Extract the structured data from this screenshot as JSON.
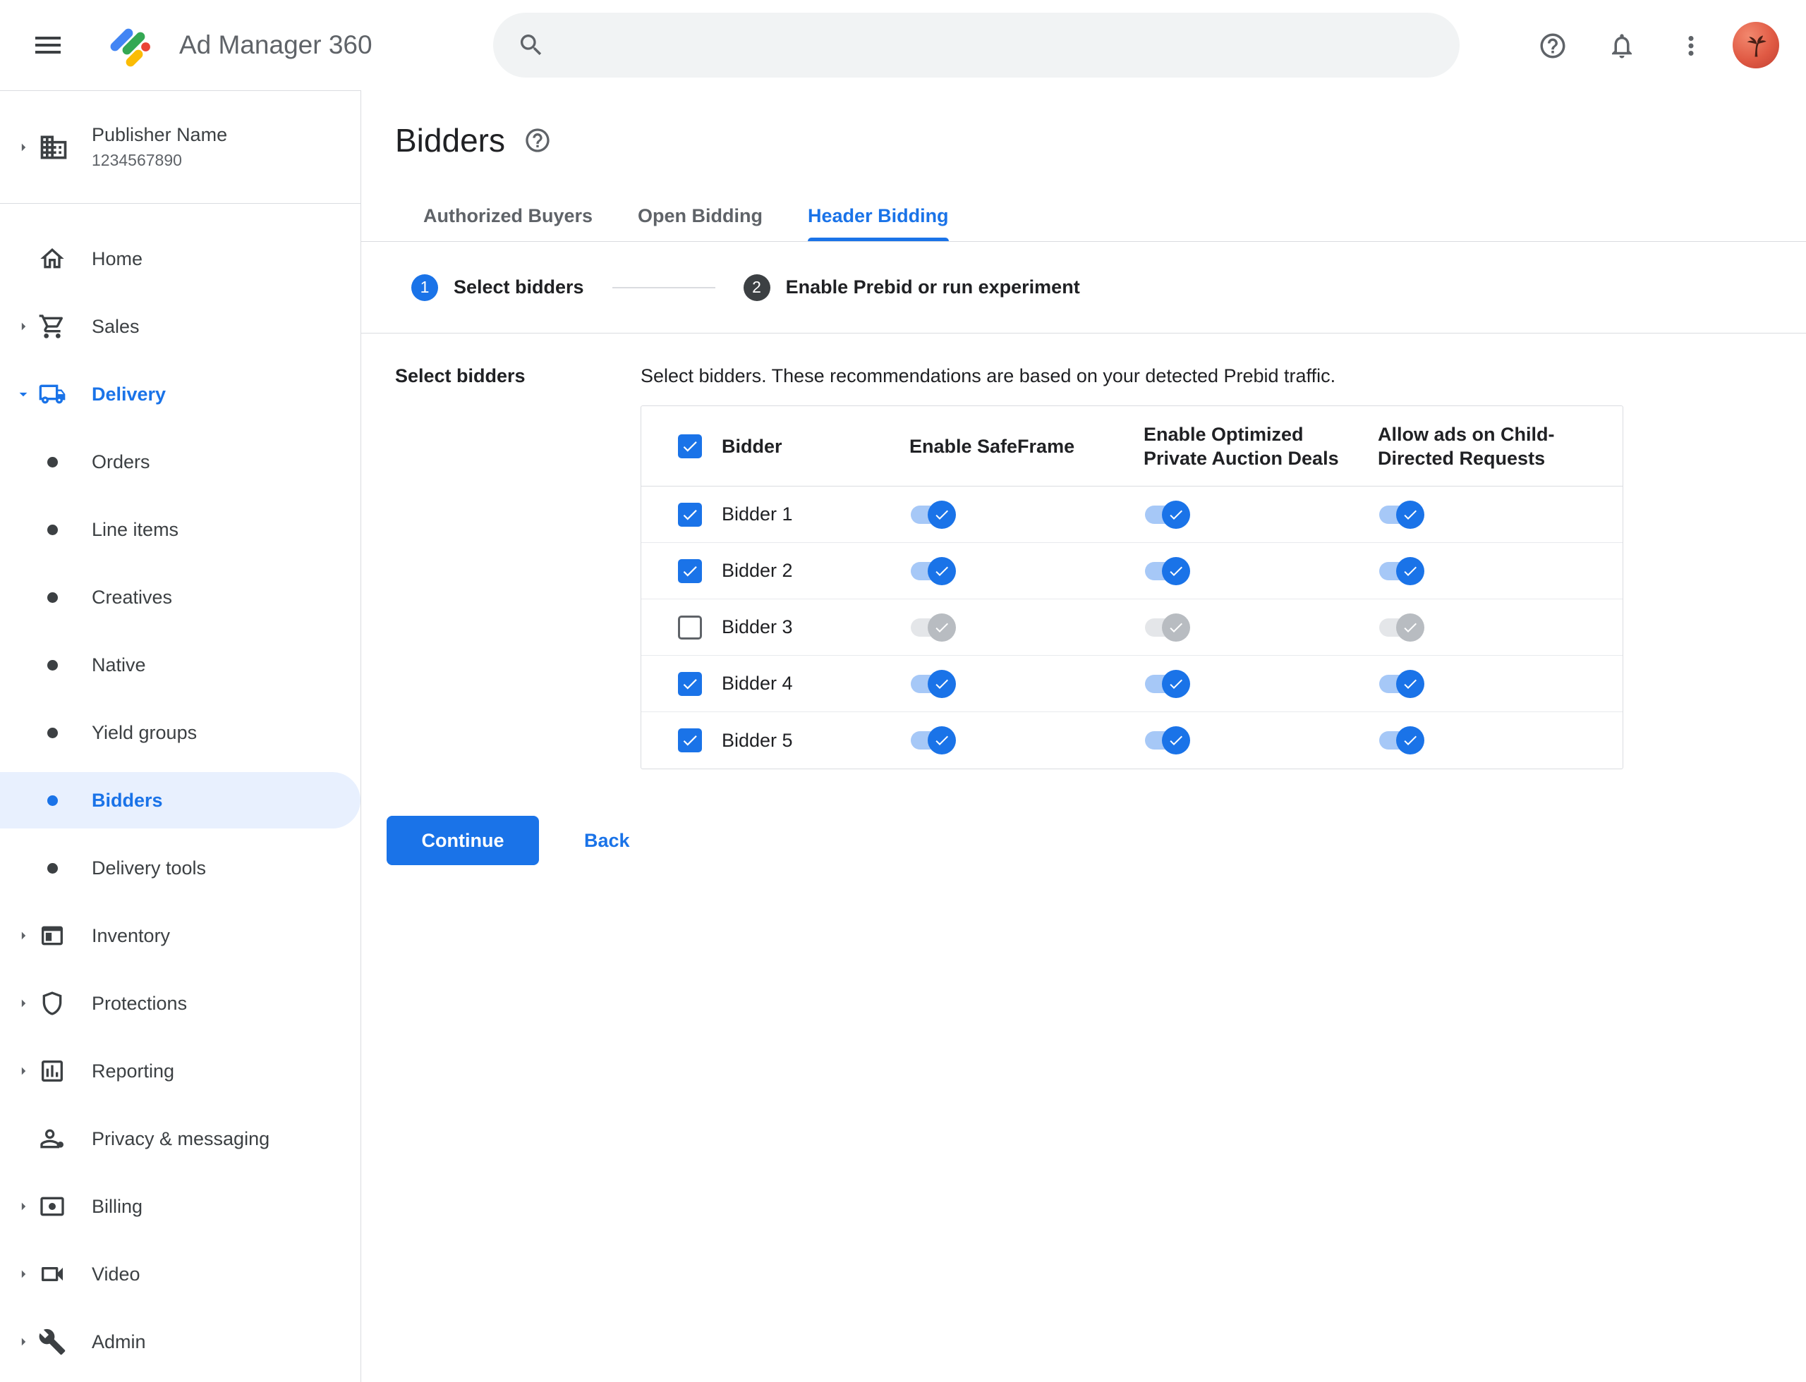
{
  "topbar": {
    "app_title": "Ad Manager 360",
    "search_value": ""
  },
  "sidebar": {
    "publisher_name": "Publisher Name",
    "publisher_id": "1234567890",
    "items": [
      {
        "label": "Home",
        "icon": "home-icon",
        "arrow": "none",
        "level": 0
      },
      {
        "label": "Sales",
        "icon": "cart-icon",
        "arrow": "right",
        "level": 0
      },
      {
        "label": "Delivery",
        "icon": "truck-icon",
        "arrow": "down",
        "level": 0,
        "active": true
      },
      {
        "label": "Orders",
        "icon": "bullet",
        "arrow": "none",
        "level": 1
      },
      {
        "label": "Line items",
        "icon": "bullet",
        "arrow": "none",
        "level": 1
      },
      {
        "label": "Creatives",
        "icon": "bullet",
        "arrow": "none",
        "level": 1
      },
      {
        "label": "Native",
        "icon": "bullet",
        "arrow": "none",
        "level": 1
      },
      {
        "label": "Yield groups",
        "icon": "bullet",
        "arrow": "none",
        "level": 1
      },
      {
        "label": "Bidders",
        "icon": "bullet",
        "arrow": "none",
        "level": 1,
        "selected": true
      },
      {
        "label": "Delivery tools",
        "icon": "bullet",
        "arrow": "none",
        "level": 1
      },
      {
        "label": "Inventory",
        "icon": "inventory-icon",
        "arrow": "right",
        "level": 0
      },
      {
        "label": "Protections",
        "icon": "shield-icon",
        "arrow": "right",
        "level": 0
      },
      {
        "label": "Reporting",
        "icon": "report-icon",
        "arrow": "right",
        "level": 0
      },
      {
        "label": "Privacy & messaging",
        "icon": "privacy-icon",
        "arrow": "none",
        "level": 0
      },
      {
        "label": "Billing",
        "icon": "billing-icon",
        "arrow": "right",
        "level": 0
      },
      {
        "label": "Video",
        "icon": "video-icon",
        "arrow": "right",
        "level": 0
      },
      {
        "label": "Admin",
        "icon": "admin-icon",
        "arrow": "right",
        "level": 0
      }
    ]
  },
  "main": {
    "page_title": "Bidders",
    "tabs": [
      {
        "label": "Authorized Buyers",
        "active": false
      },
      {
        "label": "Open Bidding",
        "active": false
      },
      {
        "label": "Header Bidding",
        "active": true
      }
    ],
    "stepper": [
      {
        "number": "1",
        "label": "Select bidders",
        "state": "active"
      },
      {
        "number": "2",
        "label": "Enable Prebid or run experiment",
        "state": "upcoming"
      }
    ],
    "section_label": "Select bidders",
    "description": "Select bidders. These recommendations are based on your detected Prebid traffic.",
    "table": {
      "columns": [
        "Bidder",
        "Enable SafeFrame",
        "Enable Optimized Private Auction Deals",
        "Allow ads on Child-Directed Requests"
      ],
      "header_checkbox_checked": true,
      "rows": [
        {
          "name": "Bidder 1",
          "checked": true,
          "safeframe": true,
          "optimized_deals": true,
          "child_directed": true
        },
        {
          "name": "Bidder 2",
          "checked": true,
          "safeframe": true,
          "optimized_deals": true,
          "child_directed": true
        },
        {
          "name": "Bidder 3",
          "checked": false,
          "safeframe": false,
          "optimized_deals": false,
          "child_directed": false
        },
        {
          "name": "Bidder 4",
          "checked": true,
          "safeframe": true,
          "optimized_deals": true,
          "child_directed": true
        },
        {
          "name": "Bidder 5",
          "checked": true,
          "safeframe": true,
          "optimized_deals": true,
          "child_directed": true
        }
      ]
    },
    "continue_label": "Continue",
    "back_label": "Back"
  },
  "colors": {
    "accent_blue": "#1a73e8",
    "selected_bg": "#e8f0fe",
    "text_primary": "#202124",
    "text_secondary": "#5f6368",
    "divider": "#dadce0",
    "toggle_on_track": "#a6c8f7",
    "toggle_off_track": "#e4e6e9",
    "toggle_off_thumb": "#b8bcc1",
    "step_inactive": "#3c4043"
  }
}
